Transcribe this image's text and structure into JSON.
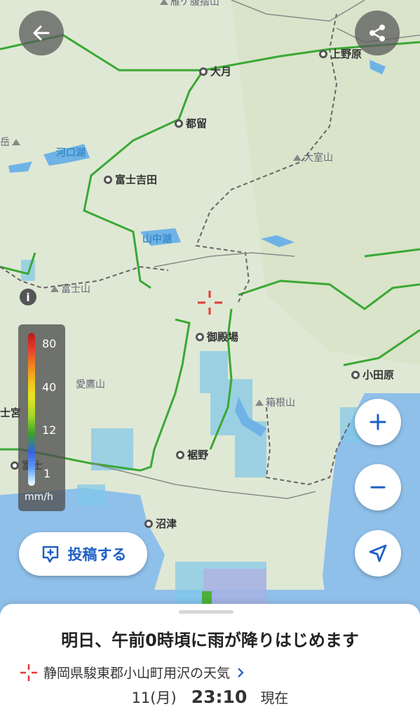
{
  "places": [
    {
      "id": "uenohara",
      "name": "上野原"
    },
    {
      "id": "otsuki",
      "name": "大月"
    },
    {
      "id": "tsuru",
      "name": "都留"
    },
    {
      "id": "fujiyoshida",
      "name": "富士吉田"
    },
    {
      "id": "gotemba",
      "name": "御殿場"
    },
    {
      "id": "odawara",
      "name": "小田原"
    },
    {
      "id": "susono",
      "name": "裾野"
    },
    {
      "id": "numazu",
      "name": "沼津"
    },
    {
      "id": "fujinomiya",
      "name": "士宮"
    },
    {
      "id": "fuji",
      "name": "富士"
    }
  ],
  "mountains": [
    {
      "id": "omuroyama",
      "name": "大室山"
    },
    {
      "id": "fujisan",
      "name": "富士山"
    },
    {
      "id": "hakoneyama",
      "name": "箱根山"
    },
    {
      "id": "ashitakayama",
      "name": "愛鷹山"
    },
    {
      "id": "kitagashi",
      "name": "岳"
    },
    {
      "id": "top_partial",
      "name": "雁ケ腹摺山"
    }
  ],
  "lakes": [
    {
      "id": "kawaguchiko",
      "name": "河口湖"
    },
    {
      "id": "yamanakako",
      "name": "山中湖"
    }
  ],
  "legend": {
    "ticks": [
      "80",
      "40",
      "12",
      "1"
    ],
    "unit": "mm/h"
  },
  "buttons": {
    "post_label": "投稿する"
  },
  "icons": {
    "back": "arrow-left-icon",
    "share": "share-icon",
    "zoom_in": "plus-icon",
    "zoom_out": "minus-icon",
    "locate": "navigation-arrow-icon",
    "post": "chat-bubble-plus-icon",
    "target": "crosshair-icon",
    "info": "info-icon"
  },
  "sheet": {
    "headline": "明日、午前0時頃に雨が降りはじめます",
    "location": "静岡県駿東郡小山町用沢の天気",
    "date": "11(月)",
    "time": "23:10",
    "now_label": "現在"
  },
  "colors": {
    "accent": "#1e5fc6",
    "crosshair": "#e53935",
    "boundary": "#3aa835"
  }
}
